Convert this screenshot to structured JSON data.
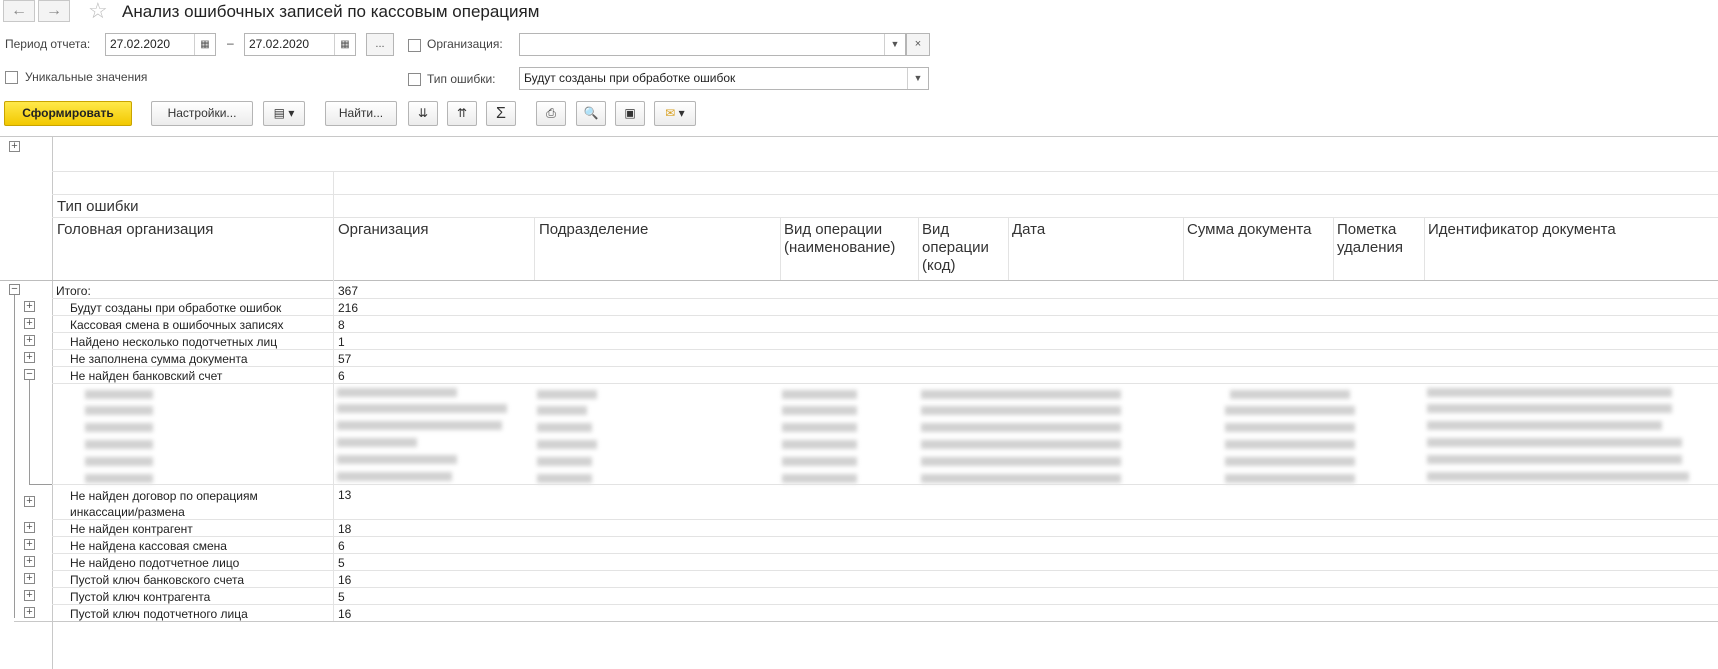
{
  "window": {
    "title": "Анализ ошибочных записей по кассовым операциям",
    "back_icon": "←",
    "forward_icon": "→",
    "favorite_icon": "☆"
  },
  "form": {
    "period_label": "Период отчета:",
    "date_from": "27.02.2020",
    "date_separator": "–",
    "date_to": "27.02.2020",
    "period_choose": "...",
    "organization_label": "Организация:",
    "organization_value": "",
    "unique_label": "Уникальные значения",
    "error_type_label": "Тип ошибки:",
    "error_type_value": "Будут созданы при обработке ошибок"
  },
  "toolbar": {
    "generate": "Сформировать",
    "settings": "Настройки...",
    "find": "Найти..."
  },
  "report": {
    "col_error_type": "Тип ошибки",
    "columns": [
      "Головная организация",
      "Организация",
      "Подразделение",
      "Вид операции (наименование)",
      "Вид операции (код)",
      "Дата",
      "Сумма документа",
      "Пометка удаления",
      "Идентификатор документа"
    ],
    "total_label": "Итого:",
    "total_value": "367",
    "groups": [
      {
        "label": "Будут созданы при обработке ошибок",
        "count": "216"
      },
      {
        "label": "Кассовая смена в ошибочных записях",
        "count": "8"
      },
      {
        "label": "Найдено несколько подотчетных лиц",
        "count": "1"
      },
      {
        "label": "Не заполнена сумма документа",
        "count": "57"
      },
      {
        "label": "Не найден банковский счет",
        "count": "6"
      },
      {
        "label": "Не найден договор по операциям инкассации/размена",
        "count": "13"
      },
      {
        "label": "Не найден контрагент",
        "count": "18"
      },
      {
        "label": "Не найдена кассовая смена",
        "count": "6"
      },
      {
        "label": "Не найдено подотчетное лицо",
        "count": "5"
      },
      {
        "label": "Пустой ключ банковского счета",
        "count": "16"
      },
      {
        "label": "Пустой ключ контрагента",
        "count": "5"
      },
      {
        "label": "Пустой ключ подотчетного лица",
        "count": "16"
      }
    ],
    "expand_symbol": "+",
    "collapse_symbol": "−"
  }
}
